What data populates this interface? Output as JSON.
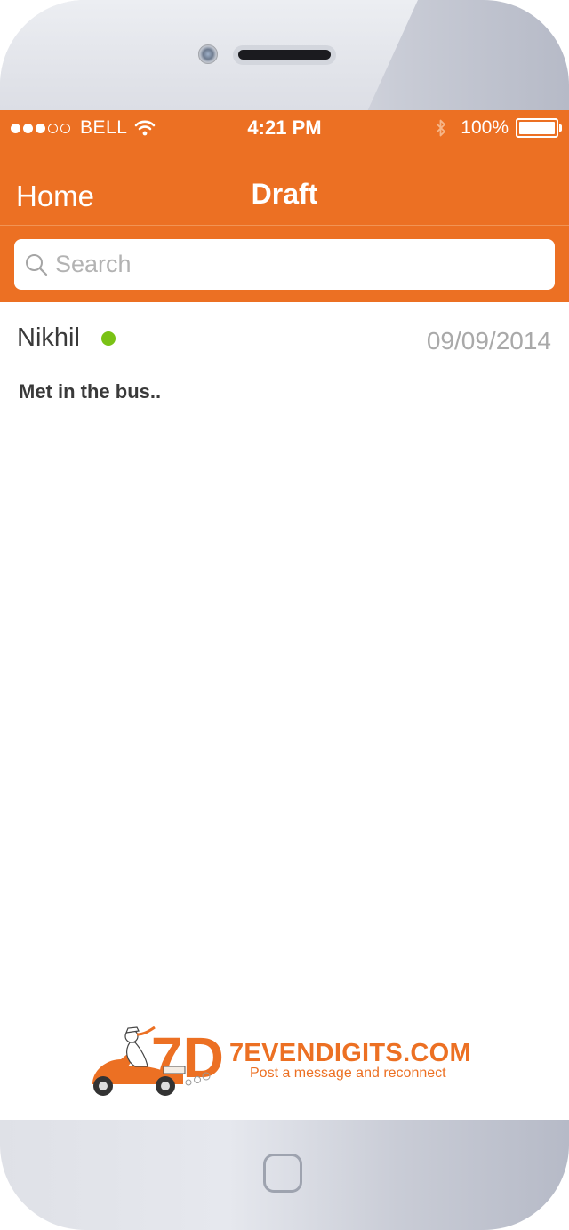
{
  "status_bar": {
    "carrier": "BELL",
    "signal_bars_filled": 3,
    "signal_bars_total": 5,
    "time": "4:21 PM",
    "battery_percent_label": "100%",
    "battery_level": 1.0
  },
  "nav_bar": {
    "back_label": "Home",
    "title": "Draft"
  },
  "search": {
    "placeholder": "Search",
    "value": ""
  },
  "drafts": [
    {
      "name": "Nikhil",
      "online": true,
      "date": "09/09/2014",
      "message": "Met in the bus.."
    }
  ],
  "brand": {
    "logo_text": "7D",
    "name": "7EVENDIGITS.COM",
    "tagline": "Post a message and reconnect"
  },
  "colors": {
    "accent": "#ec7023",
    "online": "#7ac215",
    "date_text": "#a9a9a9"
  }
}
